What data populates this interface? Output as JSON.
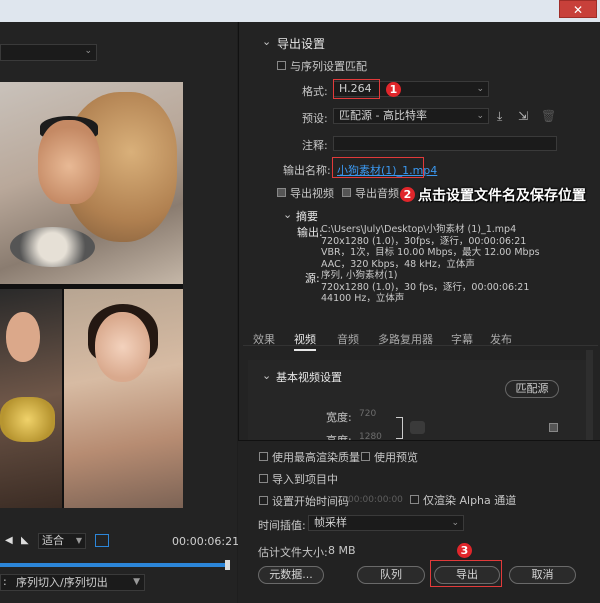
{
  "window": {
    "close_glyph": "✕"
  },
  "preview": {
    "fit_label": "适合",
    "timecode": "00:00:06:21",
    "range_label": "序列切入/序列切出"
  },
  "export_settings": {
    "section_title": "导出设置",
    "match_sequence_label": "与序列设置匹配",
    "format_label": "格式:",
    "format_value": "H.264",
    "preset_label": "预设:",
    "preset_value": "匹配源 - 高比特率",
    "comment_label": "注释:",
    "output_name_label": "输出名称:",
    "output_name_value": "小狗素材(1)_1.mp4",
    "export_video_label": "导出视频",
    "export_audio_label": "导出音频",
    "summary_title": "摘要",
    "output_label": "输出:",
    "output_lines": [
      "C:\\Users\\July\\Desktop\\小狗素材 (1)_1.mp4",
      "720x1280 (1.0)，30fps，逐行，00:00:06:21",
      "VBR，1次，目标 10.00 Mbps，最大 12.00 Mbps",
      "AAC，320 Kbps，48  kHz，立体声"
    ],
    "source_label": "源:",
    "source_lines": [
      "序列, 小狗素材(1)",
      "720x1280 (1.0)，30 fps，逐行，00:00:06:21",
      "44100 Hz，立体声"
    ]
  },
  "annotations": {
    "step1": "1",
    "step2": "2",
    "step2_text": "点击设置文件名及保存位置",
    "step3": "3"
  },
  "tabs": [
    "效果",
    "视频",
    "音频",
    "多路复用器",
    "字幕",
    "发布"
  ],
  "active_tab": "视频",
  "video_settings": {
    "section_title": "基本视频设置",
    "match_source_button": "匹配源",
    "width_label": "宽度:",
    "width_value": "720",
    "height_label": "高度:",
    "height_value": "1280"
  },
  "bottom_options": {
    "max_render_quality": "使用最高渲染质量",
    "use_previews": "使用预览",
    "import_to_project": "导入到项目中",
    "set_start_timecode": "设置开始时间码",
    "start_timecode_value": "00:00:00:00",
    "render_alpha_only": "仅渲染 Alpha 通道",
    "time_interp_label": "时间插值:",
    "time_interp_value": "帧采样",
    "est_file_size_label": "估计文件大小:",
    "est_file_size_value": "8 MB"
  },
  "buttons": {
    "metadata": "元数据...",
    "queue": "队列",
    "export": "导出",
    "cancel": "取消"
  },
  "colors": {
    "accent_blue": "#2c86d9",
    "annotation_red": "#e0262b"
  }
}
